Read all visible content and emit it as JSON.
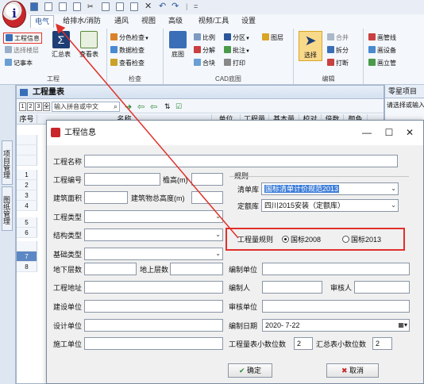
{
  "quick_access": {
    "separator": "|",
    "trailing": "="
  },
  "app_logo_text": "i",
  "ribbon": {
    "tabs": [
      "电气",
      "给排水/消防",
      "通风",
      "视图",
      "高级",
      "视频/工具",
      "设置"
    ],
    "active_tab": "电气",
    "groups": [
      {
        "title": "工程",
        "items": [
          "工程信息",
          "选择楼层",
          "汇总表",
          "记事本",
          "查看表"
        ]
      },
      {
        "title": "检查",
        "items": [
          "分色检查",
          "数据检查",
          "查看检查"
        ]
      },
      {
        "title": "CAD底图",
        "items": [
          "底图",
          "比例",
          "分区",
          "图层",
          "分解",
          "批注",
          "合块",
          "打印"
        ]
      },
      {
        "title": "编辑",
        "items": [
          "选择",
          "合并",
          "拆分",
          "打断"
        ]
      },
      {
        "title": "",
        "items": [
          "画管线",
          "画设备",
          "画立管"
        ]
      }
    ]
  },
  "left_tabs": [
    "项目管理",
    "图纸管理"
  ],
  "main_window": {
    "title": "工程量表",
    "toolbar": {
      "nav_buttons": [
        "1",
        "2",
        "3",
        "全"
      ],
      "search_placeholder": "输入拼音或中文",
      "search_icon": "search-icon",
      "tool_icons": [
        "arrow-right-icon",
        "arrow-left-icon",
        "arrow-left-icon",
        "sort-icon",
        "check-list-icon"
      ]
    },
    "columns": [
      "序号",
      "名称",
      "单位",
      "工程量",
      "基本量",
      "校对",
      "倍数",
      "颜色"
    ],
    "rows": [
      "1",
      "2",
      "3",
      "4",
      "5",
      "6",
      "7",
      "8"
    ],
    "selected_row": "7"
  },
  "right_panel": {
    "title": "零星项目",
    "hint": "请选择或输入"
  },
  "dialog": {
    "title": "工程信息",
    "fields": {
      "project_name": {
        "label": "工程名称",
        "value": ""
      },
      "project_no": {
        "label": "工程编号",
        "value": ""
      },
      "eave_height": {
        "label": "檐高(m)",
        "value": ""
      },
      "building_area": {
        "label": "建筑面积",
        "value": ""
      },
      "total_height": {
        "label": "建筑物总高度(m)",
        "value": ""
      },
      "project_type": {
        "label": "工程类型",
        "value": ""
      },
      "structure_type": {
        "label": "结构类型",
        "value": ""
      },
      "foundation_type": {
        "label": "基础类型",
        "value": ""
      },
      "basement_floors": {
        "label": "地下层数",
        "value": ""
      },
      "above_floors": {
        "label": "地上层数",
        "value": ""
      },
      "project_address": {
        "label": "工程地址",
        "value": ""
      },
      "construction_unit": {
        "label": "建设单位",
        "value": ""
      },
      "design_unit": {
        "label": "设计单位",
        "value": ""
      },
      "contractor": {
        "label": "施工单位",
        "value": ""
      },
      "compiling_unit": {
        "label": "编制单位",
        "value": ""
      },
      "compiler": {
        "label": "编制人",
        "value": ""
      },
      "reviewer": {
        "label": "审核人",
        "value": ""
      },
      "review_unit": {
        "label": "审核单位",
        "value": ""
      },
      "compile_date": {
        "label": "编制日期",
        "value": "2020-  7-22"
      },
      "qty_decimals": {
        "label": "工程量表小数位数",
        "value": "2"
      },
      "summary_decimals": {
        "label": "汇总表小数位数",
        "value": "2"
      }
    },
    "rules": {
      "group_label": "规则",
      "bill_library": {
        "label": "清单库",
        "value": "国标清单计价规范2013"
      },
      "quota_library": {
        "label": "定额库",
        "value": "四川2015安装（定额库）"
      },
      "qty_rule": {
        "label": "工程量规则",
        "options": [
          "国标2008",
          "国标2013"
        ],
        "selected": "国标2008"
      }
    },
    "buttons": {
      "ok": "确定",
      "cancel": "取消"
    },
    "window_controls": {
      "minimize": "—",
      "maximize": "☐",
      "close": "✕"
    }
  },
  "colors": {
    "accent": "#2b579a",
    "annotation": "#e0302a",
    "selection": "#5b87c4"
  }
}
